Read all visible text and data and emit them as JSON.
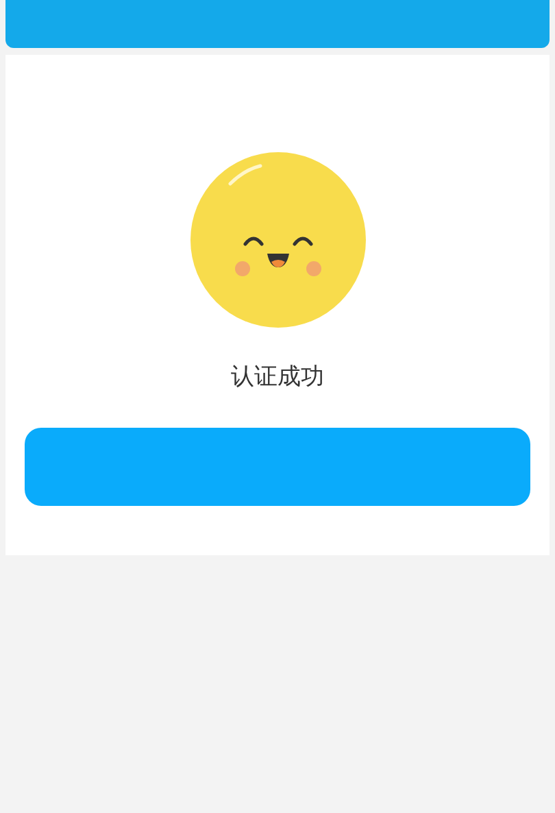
{
  "result": {
    "kind": "success",
    "message": "认证成功"
  }
}
